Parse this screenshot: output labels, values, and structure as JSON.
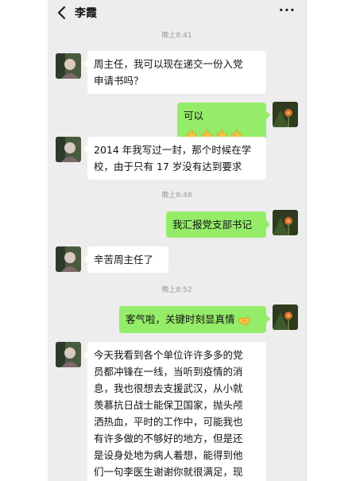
{
  "header": {
    "title": "李霞",
    "more": "···"
  },
  "timestamps": [
    "晚上8:41",
    "晚上8:48",
    "晚上8:52"
  ],
  "messages": [
    {
      "sender": "李霞",
      "side": "left",
      "text_lines": [
        "周主任，我可以现在递交一份入党",
        "申请书吗？"
      ]
    },
    {
      "sender": "me",
      "side": "right",
      "text": "可以",
      "emoji": [
        "thumbs-up",
        "thumbs-up",
        "thumbs-up",
        "thumbs-up"
      ]
    },
    {
      "sender": "李霞",
      "side": "left",
      "text_lines": [
        "2014 年我写过一封，那个时候在学",
        "校，由于只有 17 岁没有达到要求"
      ]
    },
    {
      "sender": "me",
      "side": "right",
      "text": "我汇报党支部书记"
    },
    {
      "sender": "李霞",
      "side": "left",
      "text": "辛苦周主任了"
    },
    {
      "sender": "me",
      "side": "right",
      "text": "客气啦，关键时刻显真情",
      "emoji": [
        "handshake"
      ]
    },
    {
      "sender": "李霞",
      "side": "left",
      "text_lines": [
        "今天我看到各个单位许许多多的党",
        "员都冲锋在一线，当听到疫情的消",
        "息，我也很想去支援武汉，从小就",
        "羡慕抗日战士能保卫国家，抛头颅",
        "洒热血，平时的工作中，可能我也",
        "有许多做的不够好的地方，但是还",
        "是设身处地为病人着想，能得到他",
        "们一句李医生谢谢你就很满足，现"
      ]
    }
  ],
  "colors": {
    "background": "#ededed",
    "incoming_bubble": "#ffffff",
    "outgoing_bubble": "#95ec69",
    "timestamp": "#9a9a9a"
  }
}
